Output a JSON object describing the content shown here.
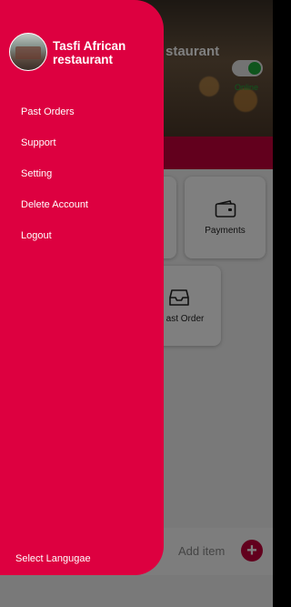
{
  "restaurant": {
    "name": "Tasfi African restaurant",
    "header_name_partial": "staurant",
    "status": "Online"
  },
  "drawer": {
    "title": "Tasfi African restaurant",
    "items": [
      {
        "label": "Past Orders"
      },
      {
        "label": "Support"
      },
      {
        "label": "Setting"
      },
      {
        "label": "Delete Account"
      },
      {
        "label": "Logout"
      }
    ],
    "footer_label": "Select Langugae"
  },
  "dashboard": {
    "cards": [
      {
        "label": "Payments",
        "icon": "wallet-icon"
      },
      {
        "label": "ast Order",
        "icon": "inbox-tray-icon"
      }
    ]
  },
  "bottom": {
    "add_label": "Add item",
    "add_icon": "plus-icon"
  },
  "colors": {
    "accent": "#dd0040",
    "band": "#c4003a",
    "online": "#1faa3a"
  }
}
